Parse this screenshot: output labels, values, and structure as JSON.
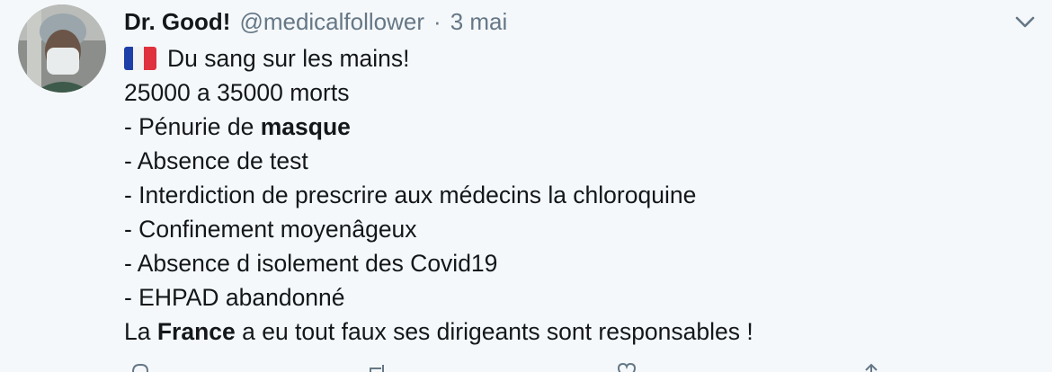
{
  "tweet": {
    "display_name": "Dr. Good!",
    "handle": "@medicalfollower",
    "separator": "·",
    "timestamp": "3 mai",
    "flag_icon": "france-flag-icon",
    "text_lines": {
      "l1": "Du sang sur les mains!",
      "l2": "25000 a 35000 morts",
      "l3_pre": "- Pénurie de ",
      "l3_bold": "masque",
      "l4": "- Absence de test",
      "l5": "- Interdiction de prescrire aux médecins la chloroquine",
      "l6": "- Confinement moyenâgeux",
      "l7": "- Absence d isolement des Covid19",
      "l8": "- EHPAD abandonné",
      "l9_pre": "La ",
      "l9_bold": "France",
      "l9_post": " a eu tout faux ses dirigeants sont responsables !"
    }
  },
  "icons": {
    "caret": "chevron-down-icon",
    "reply": "reply-icon",
    "retweet": "retweet-icon",
    "like": "like-icon",
    "share": "share-icon"
  },
  "colors": {
    "background": "#f5f8fa",
    "text": "#14171a",
    "secondary": "#657786"
  }
}
